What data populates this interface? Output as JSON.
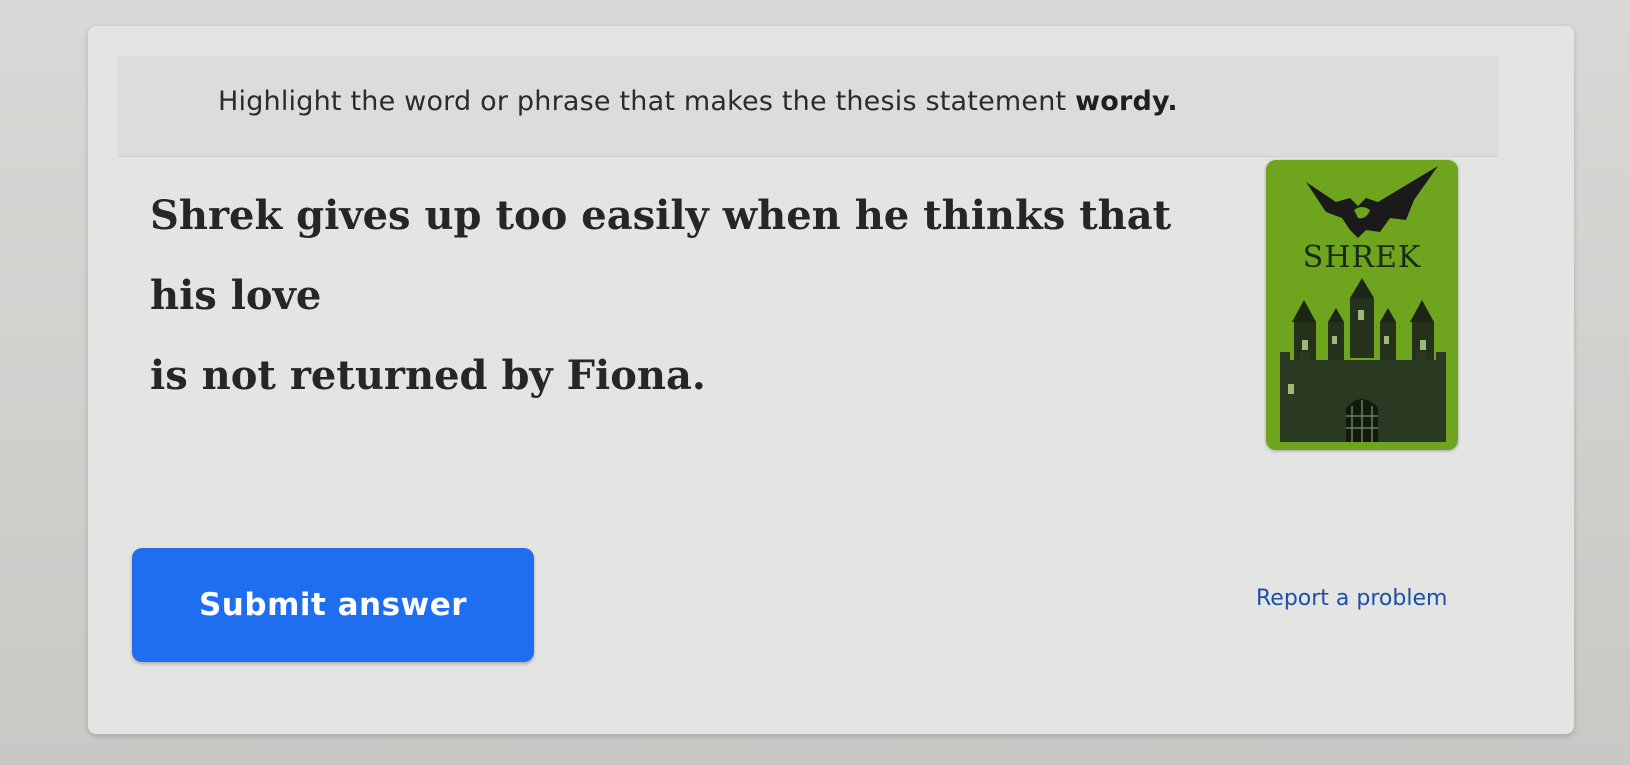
{
  "prompt": {
    "text": "Highlight the word or phrase that makes the thesis statement ",
    "emphasis": "wordy."
  },
  "thesis": {
    "line1": [
      "Shrek",
      "gives",
      "up",
      "too",
      "easily",
      "when",
      "he",
      "thinks",
      "that",
      "his",
      "love"
    ],
    "line2": [
      "is",
      "not",
      "returned",
      "by",
      "Fiona."
    ]
  },
  "cover": {
    "title": "SHREK",
    "background_color": "#6fa51e",
    "icons": [
      "dragon-icon",
      "castle-icon"
    ]
  },
  "actions": {
    "submit_label": "Submit answer",
    "report_label": "Report a problem"
  },
  "colors": {
    "primary_button": "#1f6ef0",
    "link": "#1b4fa8"
  }
}
